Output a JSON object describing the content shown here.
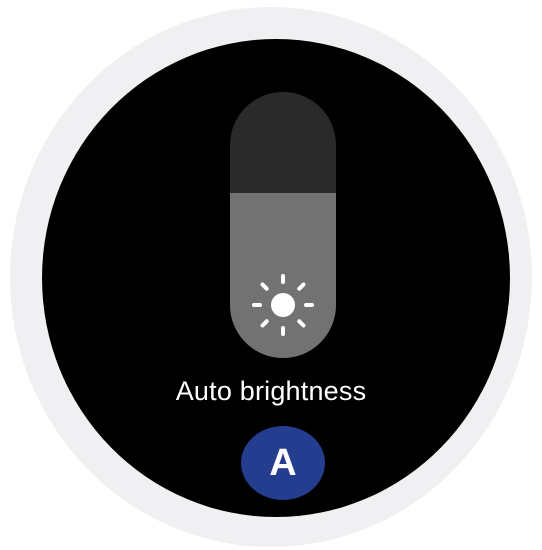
{
  "brightness": {
    "level": 0.62,
    "label": "Auto brightness",
    "icon": "sun-icon"
  },
  "auto_button": {
    "label": "A",
    "color": "#243d8f"
  },
  "colors": {
    "screen": "#000000",
    "bezel": "#f0f0f2",
    "track": "#2a2a2a",
    "fill": "#727272"
  }
}
